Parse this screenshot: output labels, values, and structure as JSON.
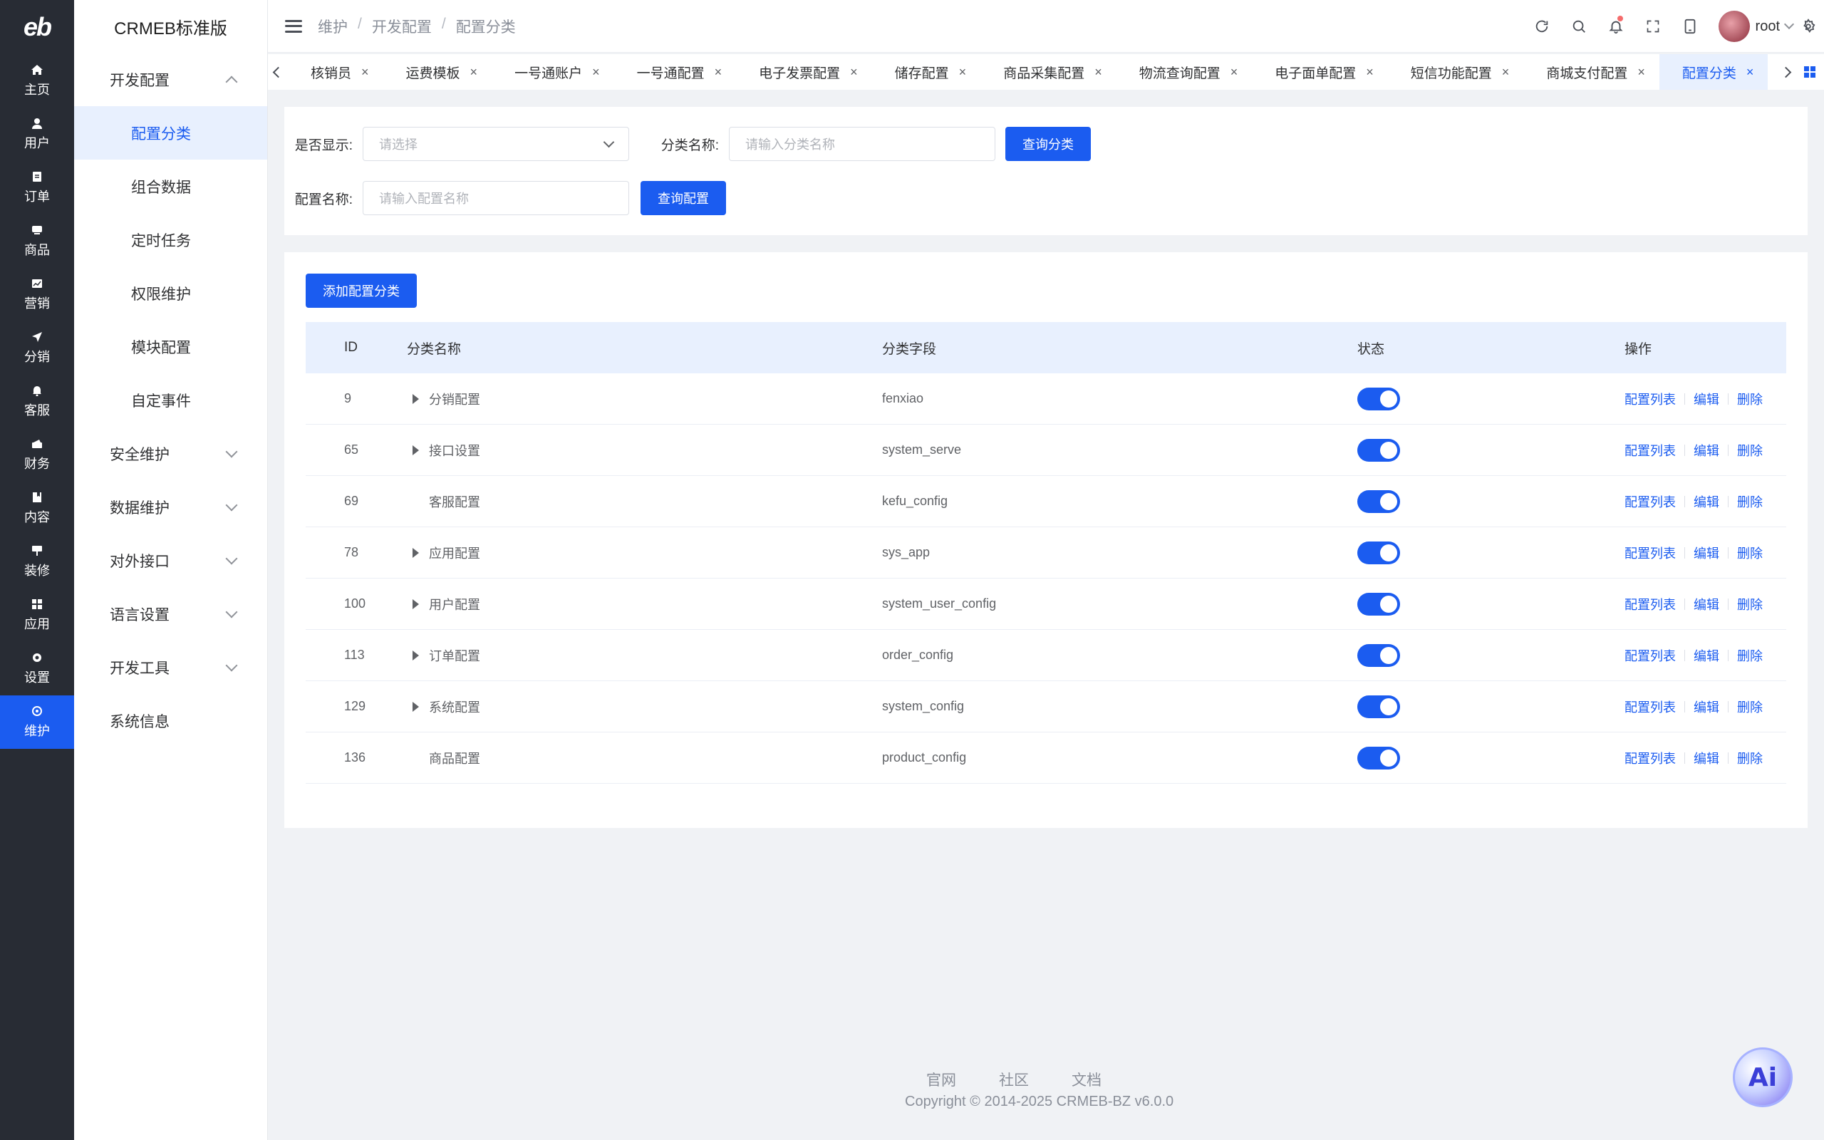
{
  "rail": {
    "logo": "eb",
    "items": [
      {
        "label": "主页",
        "icon": "home-icon"
      },
      {
        "label": "用户",
        "icon": "user-icon"
      },
      {
        "label": "订单",
        "icon": "order-icon"
      },
      {
        "label": "商品",
        "icon": "product-icon"
      },
      {
        "label": "营销",
        "icon": "marketing-icon"
      },
      {
        "label": "分销",
        "icon": "distribution-icon"
      },
      {
        "label": "客服",
        "icon": "service-icon"
      },
      {
        "label": "财务",
        "icon": "finance-icon"
      },
      {
        "label": "内容",
        "icon": "content-icon"
      },
      {
        "label": "装修",
        "icon": "decoration-icon"
      },
      {
        "label": "应用",
        "icon": "apps-icon"
      },
      {
        "label": "设置",
        "icon": "settings-icon"
      },
      {
        "label": "维护",
        "icon": "maintenance-icon"
      }
    ],
    "active_index": 12
  },
  "submenu": {
    "brand": "CRMEB标准版",
    "group_dev": "开发配置",
    "dev_items": [
      "配置分类",
      "组合数据",
      "定时任务",
      "权限维护",
      "模块配置",
      "自定事件"
    ],
    "groups": [
      "安全维护",
      "数据维护",
      "对外接口",
      "语言设置",
      "开发工具"
    ],
    "sysinfo": "系统信息"
  },
  "header": {
    "breadcrumb": [
      "维护",
      "开发配置",
      "配置分类"
    ],
    "breadcrumb_sep": "/",
    "username": "root"
  },
  "tabs": [
    {
      "label": "核销员"
    },
    {
      "label": "运费模板"
    },
    {
      "label": "一号通账户"
    },
    {
      "label": "一号通配置"
    },
    {
      "label": "电子发票配置"
    },
    {
      "label": "储存配置"
    },
    {
      "label": "商品采集配置"
    },
    {
      "label": "物流查询配置"
    },
    {
      "label": "电子面单配置"
    },
    {
      "label": "短信功能配置"
    },
    {
      "label": "商城支付配置"
    },
    {
      "label": "配置分类",
      "active": true
    }
  ],
  "tab_close_glyph": "×",
  "filter": {
    "show_label": "是否显示:",
    "show_placeholder": "请选择",
    "cat_name_label": "分类名称:",
    "cat_name_placeholder": "请输入分类名称",
    "query_cat_button": "查询分类",
    "config_name_label": "配置名称:",
    "config_name_placeholder": "请输入配置名称",
    "query_config_button": "查询配置"
  },
  "table": {
    "add_button": "添加配置分类",
    "columns": [
      "ID",
      "分类名称",
      "分类字段",
      "状态",
      "操作"
    ],
    "rows": [
      {
        "id": "9",
        "name": "分销配置",
        "field": "fenxiao",
        "expandable": true,
        "enabled": true
      },
      {
        "id": "65",
        "name": "接口设置",
        "field": "system_serve",
        "expandable": true,
        "enabled": true
      },
      {
        "id": "69",
        "name": "客服配置",
        "field": "kefu_config",
        "expandable": false,
        "enabled": true
      },
      {
        "id": "78",
        "name": "应用配置",
        "field": "sys_app",
        "expandable": true,
        "enabled": true
      },
      {
        "id": "100",
        "name": "用户配置",
        "field": "system_user_config",
        "expandable": true,
        "enabled": true
      },
      {
        "id": "113",
        "name": "订单配置",
        "field": "order_config",
        "expandable": true,
        "enabled": true
      },
      {
        "id": "129",
        "name": "系统配置",
        "field": "system_config",
        "expandable": true,
        "enabled": true
      },
      {
        "id": "136",
        "name": "商品配置",
        "field": "product_config",
        "expandable": false,
        "enabled": true
      }
    ],
    "ops": {
      "list": "配置列表",
      "edit": "编辑",
      "delete": "删除"
    }
  },
  "footer": {
    "links": [
      "官网",
      "社区",
      "文档"
    ],
    "copyright": "Copyright © 2014-2025 CRMEB-BZ v6.0.0"
  },
  "ai_button": "Ai",
  "colors": {
    "primary": "#1b5cf0",
    "rail": "#282c34",
    "header_row": "#e8f0fe"
  }
}
